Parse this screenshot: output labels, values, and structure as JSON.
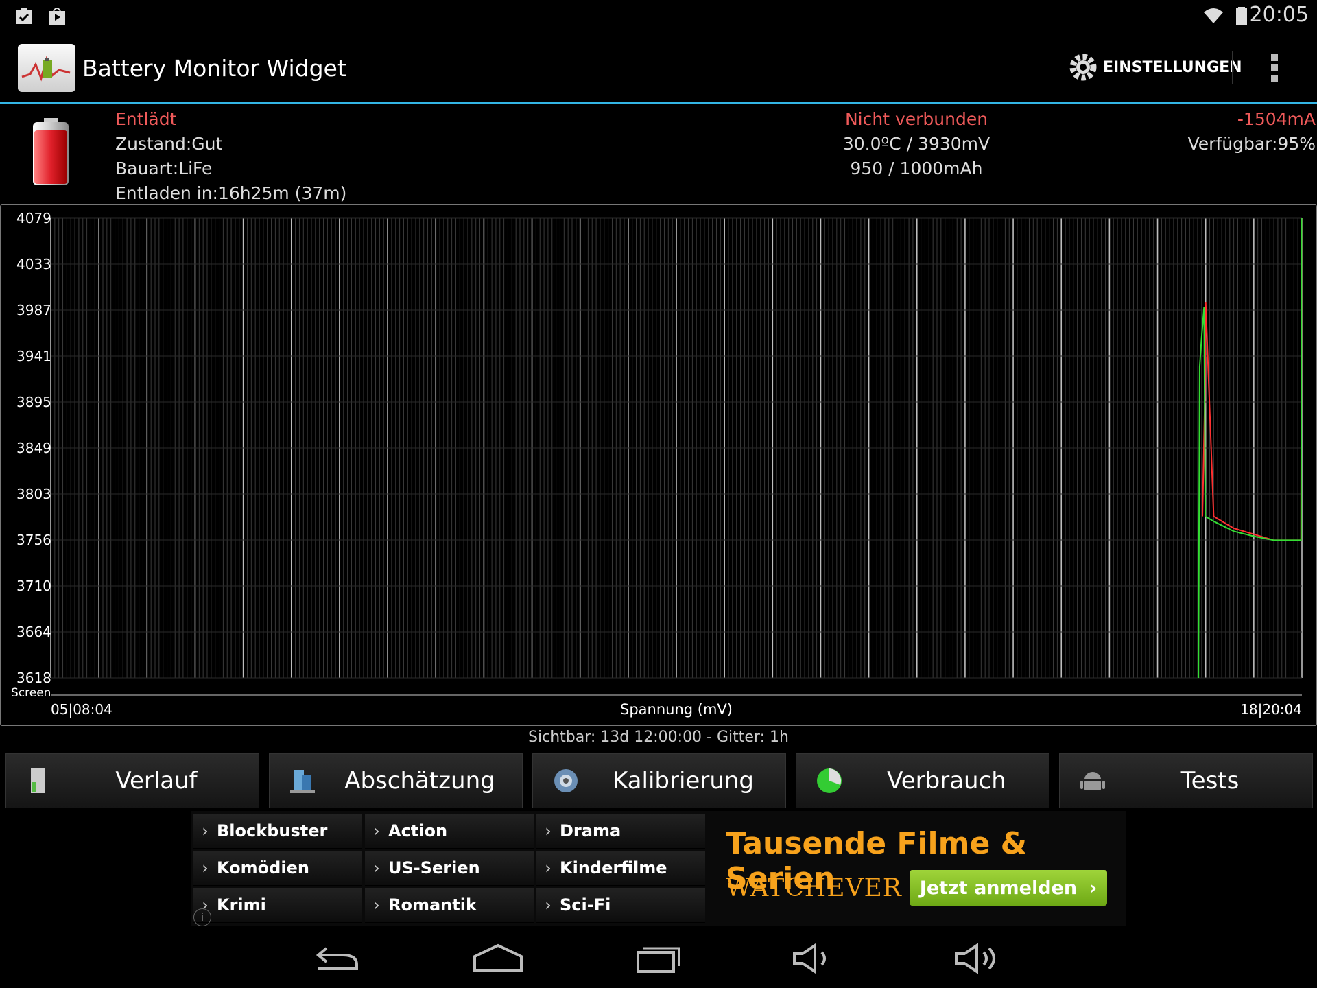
{
  "status_bar": {
    "time": "20:05",
    "icons": [
      "clipboard-check-icon",
      "play-store-icon",
      "wifi-icon",
      "battery-icon"
    ]
  },
  "action_bar": {
    "title": "Battery Monitor Widget",
    "settings_label": "EINSTELLUNGEN",
    "icons": [
      "app-icon",
      "gear-icon",
      "overflow-menu-icon"
    ]
  },
  "info": {
    "state": "Entlädt",
    "condition": "Zustand:Gut",
    "type": "Bauart:LiFe",
    "discharge_in": "Entladen in:16h25m (37m)",
    "connection": "Nicht verbunden",
    "temp_voltage": "30.0ºC / 3930mV",
    "capacity": "950 / 1000mAh",
    "current": "-1504mA",
    "available": "Verfügbar:95%",
    "colors": {
      "alert": "#f05a5a",
      "text": "#dddddd"
    }
  },
  "chart_data": {
    "type": "line",
    "ylabel": "Spannung (mV)",
    "y_ticks": [
      "4079",
      "4033",
      "3987",
      "3941",
      "3895",
      "3849",
      "3803",
      "3756",
      "3710",
      "3664",
      "3618"
    ],
    "ylim": [
      3618,
      4079
    ],
    "x_start_label": "05|08:04",
    "x_end_label": "18|20:04",
    "row_label": "Screen",
    "grid": true,
    "x_units": "hours since start (0 = 05|08:04, 312 = 18|20:04)",
    "series": [
      {
        "color": "#ff3030",
        "x": [
          287.2,
          287.8,
          288.0,
          290.0,
          295.0,
          300.0,
          305.0,
          308.0,
          310.0,
          311.8,
          311.9
        ],
        "y": [
          3780,
          3900,
          3995,
          3780,
          3768,
          3762,
          3756,
          3756,
          3756,
          3756,
          4079
        ]
      },
      {
        "color": "#33dd33",
        "x": [
          286.2,
          286.5,
          287.0,
          287.6,
          287.9,
          290.0,
          295.0,
          300.0,
          305.0,
          308.0,
          310.0,
          311.8,
          311.9
        ],
        "y": [
          3618,
          3930,
          3960,
          3990,
          3780,
          3775,
          3765,
          3760,
          3756,
          3756,
          3756,
          3756,
          4079
        ]
      }
    ],
    "visible_text": "Sichtbar: 13d 12:00:00 - Gitter: 1h"
  },
  "nav_buttons": [
    {
      "label": "Verlauf",
      "icon": "history-door-icon"
    },
    {
      "label": "Abschätzung",
      "icon": "estimate-icon"
    },
    {
      "label": "Kalibrierung",
      "icon": "calibration-icon"
    },
    {
      "label": "Verbrauch",
      "icon": "usage-pie-icon"
    },
    {
      "label": "Tests",
      "icon": "android-icon"
    }
  ],
  "ad": {
    "categories": [
      "Blockbuster",
      "Action",
      "Drama",
      "Komödien",
      "US-Serien",
      "Kinderfilme",
      "Krimi",
      "Romantik",
      "Sci-Fi"
    ],
    "headline": "Tausende Filme & Serien",
    "brand": "WATCHEVER",
    "cta": "Jetzt anmelden",
    "info_icon": "i"
  },
  "system_nav": [
    "back-icon",
    "home-icon",
    "recents-icon",
    "volume-down-icon",
    "volume-up-icon"
  ]
}
